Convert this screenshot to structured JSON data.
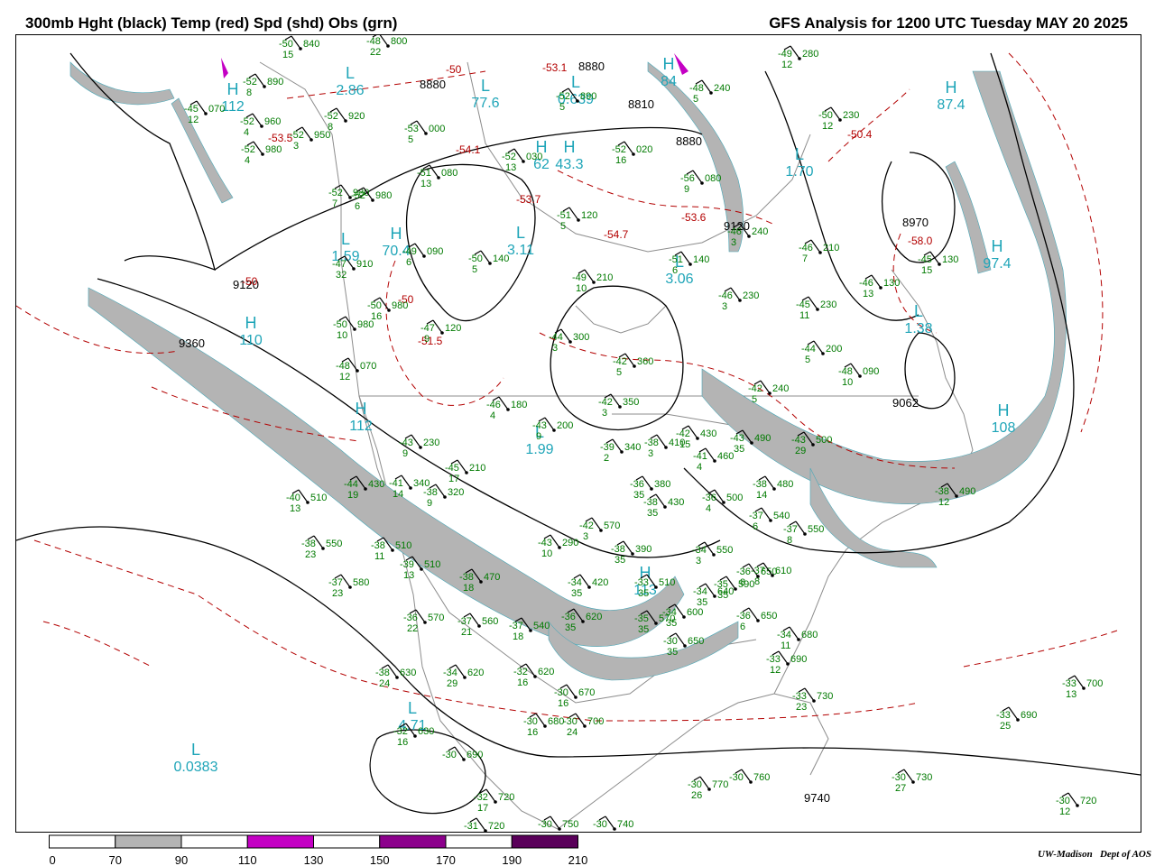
{
  "header": {
    "left_title": "300mb Hght (black) Temp (red) Spd (shd) Obs (grn)",
    "right_title": "GFS Analysis for 1200 UTC Tuesday  MAY 20 2025"
  },
  "credit": {
    "org": "UW-Madison",
    "dept": "Dept of AOS"
  },
  "colors": {
    "height": "#000000",
    "temp": "#b30000",
    "speed_shade": "#b4b4b4",
    "obs": "#007a00",
    "centers": "#1fa5b8",
    "map_lines": "#8c8c8c"
  },
  "legend": {
    "ticks": [
      "0",
      "70",
      "90",
      "110",
      "130",
      "150",
      "170",
      "190",
      "210"
    ],
    "fills": [
      "#ffffff",
      "#b4b4b4",
      "#ffffff",
      "#c400c4",
      "#ffffff",
      "#8c008c",
      "#ffffff",
      "#5a005a"
    ]
  },
  "height_labels": [
    "8880",
    "8880",
    "8810",
    "8880",
    "9120",
    "9120",
    "9360",
    "8970",
    "9062",
    "9740"
  ],
  "temp_labels": [
    "-50",
    "-53.1",
    "-54.1",
    "-53.7",
    "-54.7",
    "-53.6",
    "-51.5",
    "-53.5",
    "-50",
    "-50",
    "-50.4",
    "-58.0"
  ],
  "centers": [
    {
      "type": "L",
      "value": "2.86"
    },
    {
      "type": "L",
      "value": "77.6"
    },
    {
      "type": "L",
      "value": "0.639"
    },
    {
      "type": "H",
      "value": "62"
    },
    {
      "type": "H",
      "value": "43.3"
    },
    {
      "type": "H",
      "value": "70.4"
    },
    {
      "type": "L",
      "value": "1.59"
    },
    {
      "type": "L",
      "value": "3.11"
    },
    {
      "type": "L",
      "value": "3.06"
    },
    {
      "type": "L",
      "value": "1.70"
    },
    {
      "type": "H",
      "value": "87.4"
    },
    {
      "type": "H",
      "value": "97.4"
    },
    {
      "type": "L",
      "value": "1.38"
    },
    {
      "type": "H",
      "value": "108"
    },
    {
      "type": "H",
      "value": "110"
    },
    {
      "type": "H",
      "value": "112"
    },
    {
      "type": "L",
      "value": "1.99"
    },
    {
      "type": "H",
      "value": "113"
    },
    {
      "type": "L",
      "value": "4.71"
    },
    {
      "type": "L",
      "value": "0.0383"
    },
    {
      "type": "H",
      "value": "84"
    },
    {
      "type": "H",
      "value": "112"
    }
  ],
  "observations": [
    {
      "t": "-50",
      "h": "840",
      "w": "15"
    },
    {
      "t": "-48",
      "h": "800",
      "w": "22"
    },
    {
      "t": "-52",
      "h": "890",
      "w": "8"
    },
    {
      "t": "-49",
      "h": "280",
      "w": "12"
    },
    {
      "t": "-45",
      "h": "070",
      "w": "12"
    },
    {
      "t": "-52",
      "h": "960",
      "w": "4"
    },
    {
      "t": "-52",
      "h": "920",
      "w": "8"
    },
    {
      "t": "-53",
      "h": "000",
      "w": "5"
    },
    {
      "t": "-52",
      "h": "890",
      "w": "5"
    },
    {
      "t": "-48",
      "h": "240",
      "w": "5"
    },
    {
      "t": "-50",
      "h": "230",
      "w": "12"
    },
    {
      "t": "-52",
      "h": "950",
      "w": "3"
    },
    {
      "t": "-52",
      "h": "980",
      "w": "4"
    },
    {
      "t": "-51",
      "h": "080",
      "w": "13"
    },
    {
      "t": "-52",
      "h": "030",
      "w": "13"
    },
    {
      "t": "-52",
      "h": "020",
      "w": "16"
    },
    {
      "t": "-56",
      "h": "080",
      "w": "9"
    },
    {
      "t": "-52",
      "h": "980",
      "w": "7"
    },
    {
      "t": "-52",
      "h": "980",
      "w": "6"
    },
    {
      "t": "-51",
      "h": "120",
      "w": "5"
    },
    {
      "t": "-46",
      "h": "240",
      "w": "3"
    },
    {
      "t": "-46",
      "h": "210",
      "w": "7"
    },
    {
      "t": "-49",
      "h": "090",
      "w": "6"
    },
    {
      "t": "-50",
      "h": "140",
      "w": "5"
    },
    {
      "t": "-51",
      "h": "140",
      "w": "6"
    },
    {
      "t": "-47",
      "h": "910",
      "w": "32"
    },
    {
      "t": "-49",
      "h": "210",
      "w": "10"
    },
    {
      "t": "-46",
      "h": "130",
      "w": "13"
    },
    {
      "t": "-45",
      "h": "130",
      "w": "15"
    },
    {
      "t": "-50",
      "h": "980",
      "w": "16"
    },
    {
      "t": "-47",
      "h": "120",
      "w": "9"
    },
    {
      "t": "-46",
      "h": "230",
      "w": "3"
    },
    {
      "t": "-45",
      "h": "230",
      "w": "11"
    },
    {
      "t": "-50",
      "h": "980",
      "w": "10"
    },
    {
      "t": "-44",
      "h": "300",
      "w": "3"
    },
    {
      "t": "-44",
      "h": "200",
      "w": "5"
    },
    {
      "t": "-48",
      "h": "070",
      "w": "12"
    },
    {
      "t": "-42",
      "h": "360",
      "w": "5"
    },
    {
      "t": "-48",
      "h": "090",
      "w": "10"
    },
    {
      "t": "-42",
      "h": "240",
      "w": "5"
    },
    {
      "t": "-46",
      "h": "180",
      "w": "4"
    },
    {
      "t": "-43",
      "h": "200",
      "w": "9"
    },
    {
      "t": "-42",
      "h": "350",
      "w": "3"
    },
    {
      "t": "-42",
      "h": "430",
      "w": "15"
    },
    {
      "t": "-43",
      "h": "490",
      "w": "35"
    },
    {
      "t": "-43",
      "h": "500",
      "w": "29"
    },
    {
      "t": "-43",
      "h": "230",
      "w": "9"
    },
    {
      "t": "-39",
      "h": "340",
      "w": "2"
    },
    {
      "t": "-38",
      "h": "410",
      "w": "3"
    },
    {
      "t": "-41",
      "h": "460",
      "w": "4"
    },
    {
      "t": "-45",
      "h": "210",
      "w": "17"
    },
    {
      "t": "-44",
      "h": "430",
      "w": "19"
    },
    {
      "t": "-41",
      "h": "340",
      "w": "14"
    },
    {
      "t": "-38",
      "h": "320",
      "w": "9"
    },
    {
      "t": "-36",
      "h": "380",
      "w": "35"
    },
    {
      "t": "-38",
      "h": "480",
      "w": "14"
    },
    {
      "t": "-38",
      "h": "490",
      "w": "12"
    },
    {
      "t": "-40",
      "h": "510",
      "w": "13"
    },
    {
      "t": "-38",
      "h": "430",
      "w": "35"
    },
    {
      "t": "-36",
      "h": "500",
      "w": "4"
    },
    {
      "t": "-42",
      "h": "570",
      "w": "3"
    },
    {
      "t": "-37",
      "h": "540",
      "w": "6"
    },
    {
      "t": "-37",
      "h": "550",
      "w": "8"
    },
    {
      "t": "-38",
      "h": "550",
      "w": "23"
    },
    {
      "t": "-38",
      "h": "510",
      "w": "11"
    },
    {
      "t": "-43",
      "h": "290",
      "w": "10"
    },
    {
      "t": "-38",
      "h": "390",
      "w": "35"
    },
    {
      "t": "-34",
      "h": "550",
      "w": "3"
    },
    {
      "t": "-36",
      "h": "650",
      "w": "8"
    },
    {
      "t": "-37",
      "h": "610",
      "w": "8"
    },
    {
      "t": "-37",
      "h": "580",
      "w": "23"
    },
    {
      "t": "-39",
      "h": "510",
      "w": "13"
    },
    {
      "t": "-38",
      "h": "470",
      "w": "18"
    },
    {
      "t": "-34",
      "h": "420",
      "w": "35"
    },
    {
      "t": "-33",
      "h": "510",
      "w": "35"
    },
    {
      "t": "-34",
      "h": "640",
      "w": "35"
    },
    {
      "t": "-35",
      "h": "590",
      "w": "35"
    },
    {
      "t": "-36",
      "h": "570",
      "w": "22"
    },
    {
      "t": "-37",
      "h": "560",
      "w": "21"
    },
    {
      "t": "-37",
      "h": "540",
      "w": "18"
    },
    {
      "t": "-36",
      "h": "620",
      "w": "35"
    },
    {
      "t": "-35",
      "h": "570",
      "w": "35"
    },
    {
      "t": "-34",
      "h": "600",
      "w": "35"
    },
    {
      "t": "-36",
      "h": "650",
      "w": "6"
    },
    {
      "t": "-30",
      "h": "650",
      "w": "35"
    },
    {
      "t": "-34",
      "h": "680",
      "w": "11"
    },
    {
      "t": "-33",
      "h": "690",
      "w": "12"
    },
    {
      "t": "-38",
      "h": "630",
      "w": "24"
    },
    {
      "t": "-34",
      "h": "620",
      "w": "29"
    },
    {
      "t": "-32",
      "h": "620",
      "w": "16"
    },
    {
      "t": "-30",
      "h": "670",
      "w": "16"
    },
    {
      "t": "-33",
      "h": "730",
      "w": "23"
    },
    {
      "t": "-33",
      "h": "700",
      "w": "13"
    },
    {
      "t": "-30",
      "h": "680",
      "w": "16"
    },
    {
      "t": "-30",
      "h": "700",
      "w": "24"
    },
    {
      "t": "-32",
      "h": "630",
      "w": "16"
    },
    {
      "t": "-30",
      "h": "690",
      "w": ""
    },
    {
      "t": "-33",
      "h": "690",
      "w": "25"
    },
    {
      "t": "-30",
      "h": "760",
      "w": ""
    },
    {
      "t": "-30",
      "h": "770",
      "w": "26"
    },
    {
      "t": "-30",
      "h": "730",
      "w": "27"
    },
    {
      "t": "-32",
      "h": "720",
      "w": "17"
    },
    {
      "t": "-31",
      "h": "720",
      "w": ""
    },
    {
      "t": "-30",
      "h": "750",
      "w": ""
    },
    {
      "t": "-30",
      "h": "740",
      "w": ""
    },
    {
      "t": "-30",
      "h": "720",
      "w": "12"
    }
  ]
}
